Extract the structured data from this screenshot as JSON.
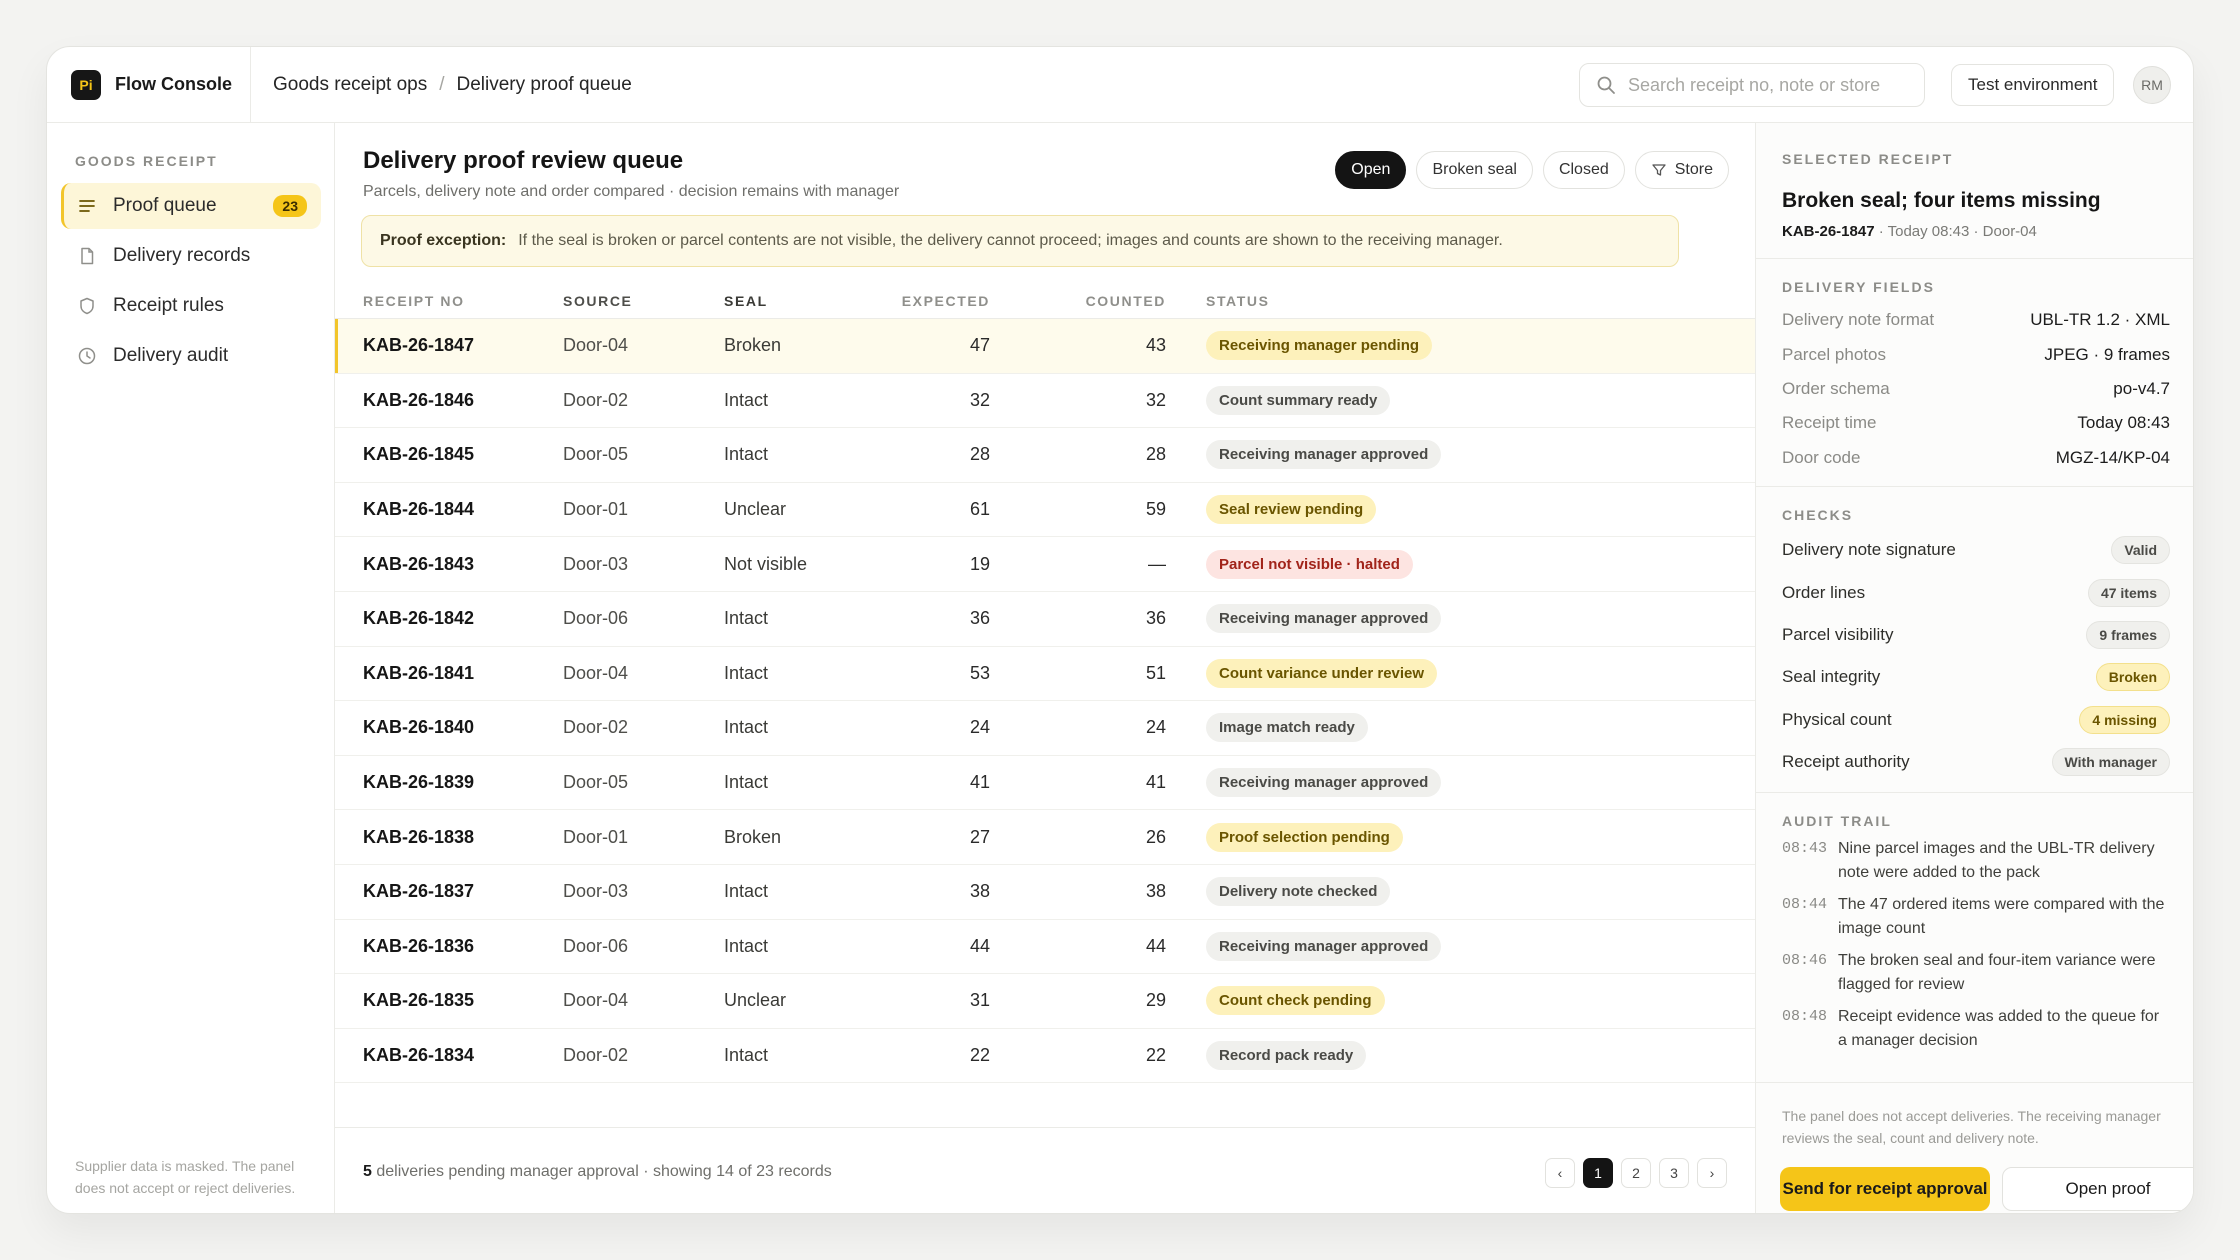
{
  "app": {
    "logo_text": "Pi",
    "name": "Flow Console"
  },
  "breadcrumb": [
    "Goods receipt ops",
    "Delivery proof queue"
  ],
  "search": {
    "placeholder": "Search receipt no, note or store",
    "value": ""
  },
  "header": {
    "environment_label": "Test environment",
    "avatar_initials": "RM"
  },
  "sidebar": {
    "section_label": "GOODS RECEIPT",
    "items": [
      {
        "label": "Proof queue",
        "icon": "list-icon",
        "badge": "23",
        "active": true
      },
      {
        "label": "Delivery records",
        "icon": "document-icon"
      },
      {
        "label": "Receipt rules",
        "icon": "shield-icon"
      },
      {
        "label": "Delivery audit",
        "icon": "clock-icon"
      }
    ],
    "footer_note": "Supplier data is masked. The panel does not accept or reject deliveries."
  },
  "main": {
    "title": "Delivery proof review queue",
    "subtitle": "Parcels, delivery note and order compared · decision remains with manager",
    "filters": [
      {
        "label": "Open",
        "active": true
      },
      {
        "label": "Broken seal"
      },
      {
        "label": "Closed"
      },
      {
        "label": "Store",
        "icon": "filter-icon"
      }
    ],
    "callout": {
      "label": "Proof exception:",
      "text": "If the seal is broken or parcel contents are not visible, the delivery cannot proceed; images and counts are shown to the receiving manager."
    },
    "columns": [
      "RECEIPT NO",
      "SOURCE",
      "SEAL",
      "EXPECTED",
      "COUNTED",
      "STATUS"
    ],
    "rows": [
      {
        "no": "KAB-26-1847",
        "source": "Door-04",
        "seal": "Broken",
        "expected": "47",
        "counted": "43",
        "status": "Receiving manager pending",
        "tone": "yellow",
        "selected": true
      },
      {
        "no": "KAB-26-1846",
        "source": "Door-02",
        "seal": "Intact",
        "expected": "32",
        "counted": "32",
        "status": "Count summary ready",
        "tone": "grey"
      },
      {
        "no": "KAB-26-1845",
        "source": "Door-05",
        "seal": "Intact",
        "expected": "28",
        "counted": "28",
        "status": "Receiving manager approved",
        "tone": "grey"
      },
      {
        "no": "KAB-26-1844",
        "source": "Door-01",
        "seal": "Unclear",
        "expected": "61",
        "counted": "59",
        "status": "Seal review pending",
        "tone": "yellow"
      },
      {
        "no": "KAB-26-1843",
        "source": "Door-03",
        "seal": "Not visible",
        "expected": "19",
        "counted": "—",
        "status": "Parcel not visible · halted",
        "tone": "red"
      },
      {
        "no": "KAB-26-1842",
        "source": "Door-06",
        "seal": "Intact",
        "expected": "36",
        "counted": "36",
        "status": "Receiving manager approved",
        "tone": "grey"
      },
      {
        "no": "KAB-26-1841",
        "source": "Door-04",
        "seal": "Intact",
        "expected": "53",
        "counted": "51",
        "status": "Count variance under review",
        "tone": "yellow"
      },
      {
        "no": "KAB-26-1840",
        "source": "Door-02",
        "seal": "Intact",
        "expected": "24",
        "counted": "24",
        "status": "Image match ready",
        "tone": "grey"
      },
      {
        "no": "KAB-26-1839",
        "source": "Door-05",
        "seal": "Intact",
        "expected": "41",
        "counted": "41",
        "status": "Receiving manager approved",
        "tone": "grey"
      },
      {
        "no": "KAB-26-1838",
        "source": "Door-01",
        "seal": "Broken",
        "expected": "27",
        "counted": "26",
        "status": "Proof selection pending",
        "tone": "yellow"
      },
      {
        "no": "KAB-26-1837",
        "source": "Door-03",
        "seal": "Intact",
        "expected": "38",
        "counted": "38",
        "status": "Delivery note checked",
        "tone": "grey"
      },
      {
        "no": "KAB-26-1836",
        "source": "Door-06",
        "seal": "Intact",
        "expected": "44",
        "counted": "44",
        "status": "Receiving manager approved",
        "tone": "grey"
      },
      {
        "no": "KAB-26-1835",
        "source": "Door-04",
        "seal": "Unclear",
        "expected": "31",
        "counted": "29",
        "status": "Count check pending",
        "tone": "yellow"
      },
      {
        "no": "KAB-26-1834",
        "source": "Door-02",
        "seal": "Intact",
        "expected": "22",
        "counted": "22",
        "status": "Record pack ready",
        "tone": "grey"
      }
    ],
    "footer": {
      "count": "5",
      "text": " deliveries pending manager approval · showing 14 of 23 records"
    },
    "pagination": {
      "prev": "‹",
      "pages": [
        "1",
        "2",
        "3"
      ],
      "current": "1",
      "next": "›"
    }
  },
  "panel": {
    "selected_label": "SELECTED RECEIPT",
    "title": "Broken seal; four items missing",
    "receipt_no": "KAB-26-1847",
    "meta": "Today 08:43 · Door-04",
    "fields_label": "DELIVERY FIELDS",
    "fields": [
      {
        "key": "Delivery note format",
        "value": "UBL-TR 1.2 · XML"
      },
      {
        "key": "Parcel photos",
        "value": "JPEG · 9 frames"
      },
      {
        "key": "Order schema",
        "value": "po-v4.7"
      },
      {
        "key": "Receipt time",
        "value": "Today 08:43"
      },
      {
        "key": "Door code",
        "value": "MGZ-14/KP-04"
      }
    ],
    "checks_label": "CHECKS",
    "checks": [
      {
        "key": "Delivery note signature",
        "value": "Valid",
        "tone": "grey"
      },
      {
        "key": "Order lines",
        "value": "47 items",
        "tone": "grey"
      },
      {
        "key": "Parcel visibility",
        "value": "9 frames",
        "tone": "grey"
      },
      {
        "key": "Seal integrity",
        "value": "Broken",
        "tone": "yellow"
      },
      {
        "key": "Physical count",
        "value": "4 missing",
        "tone": "yellow"
      },
      {
        "key": "Receipt authority",
        "value": "With manager",
        "tone": "grey"
      }
    ],
    "audit_label": "AUDIT TRAIL",
    "audit": [
      {
        "time": "08:43",
        "text": "Nine parcel images and the UBL-TR delivery note were added to the pack"
      },
      {
        "time": "08:44",
        "text": "The 47 ordered items were compared with the image count"
      },
      {
        "time": "08:46",
        "text": "The broken seal and four-item variance were flagged for review"
      },
      {
        "time": "08:48",
        "text": "Receipt evidence was added to the queue for a manager decision"
      }
    ],
    "note": "The panel does not accept deliveries. The receiving manager reviews the seal, count and delivery note.",
    "primary_action": "Send for receipt approval",
    "secondary_action": "Open proof"
  },
  "colors": {
    "accent": "#f5c518",
    "ink": "#141414",
    "danger": "#a1241a"
  }
}
